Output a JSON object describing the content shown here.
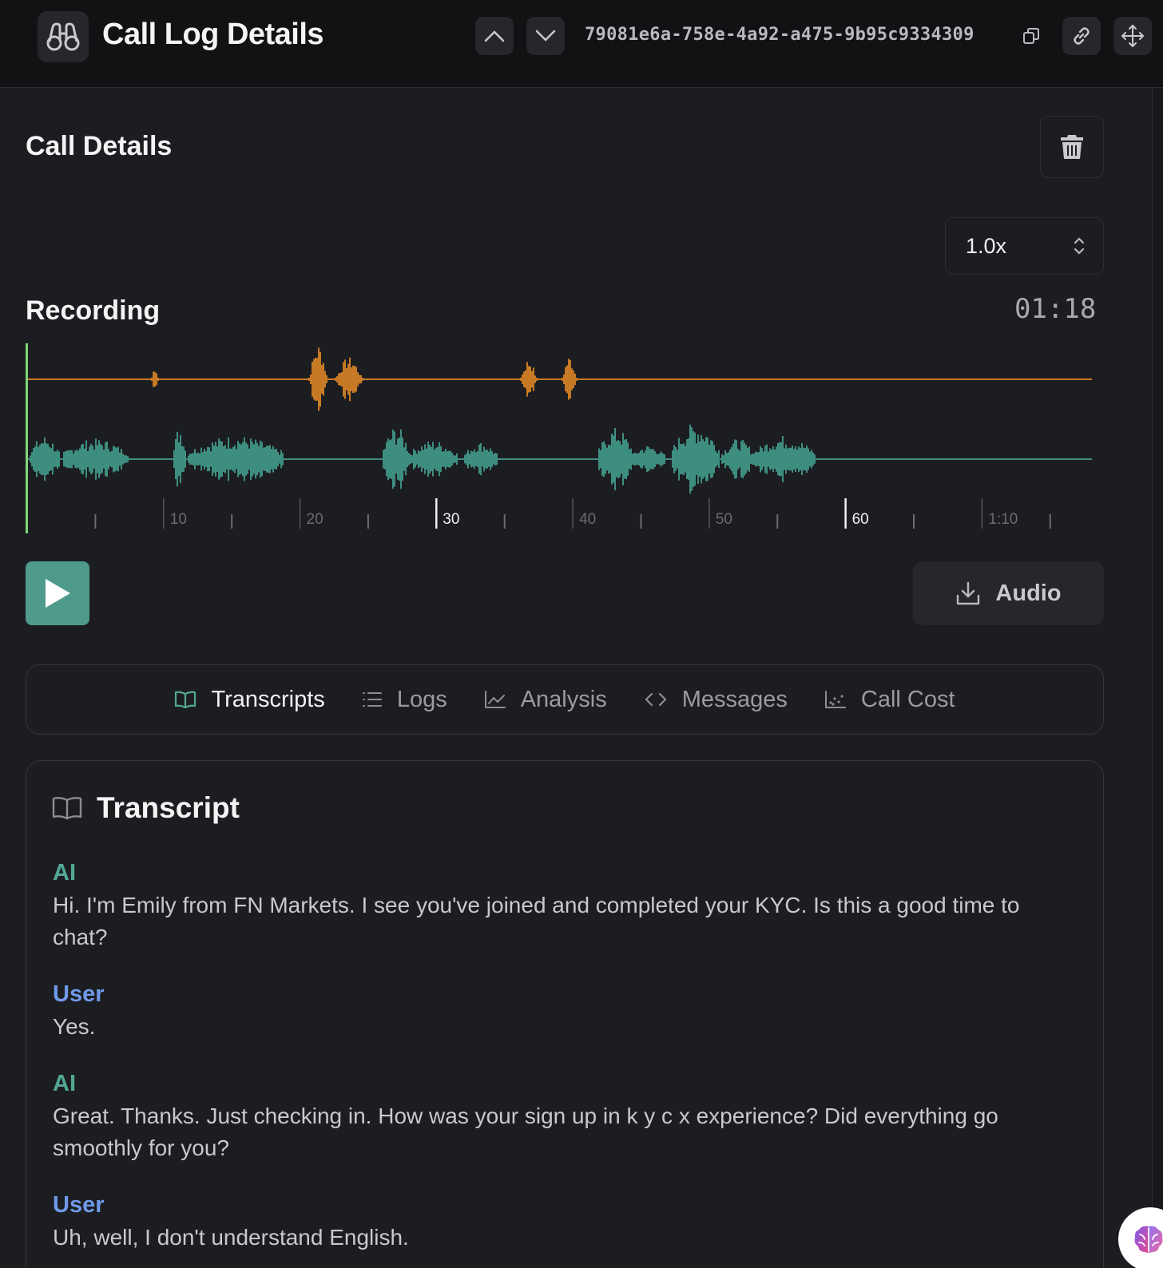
{
  "header": {
    "title": "Call Log Details",
    "call_id": "79081e6a-758e-4a92-a475-9b95c9334309"
  },
  "call_details": {
    "title": "Call Details",
    "playback_speed": "1.0x"
  },
  "recording": {
    "title": "Recording",
    "duration": "01:18",
    "time_axis": {
      "labels": [
        "10",
        "20",
        "30",
        "40",
        "50",
        "60",
        "1:10"
      ],
      "highlighted": [
        "30",
        "60"
      ]
    },
    "colors": {
      "assistant_track": "#c77a25",
      "user_track": "#3e8e80",
      "playhead": "#7ed67a"
    }
  },
  "player": {
    "audio_label": "Audio"
  },
  "tabs": [
    {
      "label": "Transcripts",
      "icon": "book-open-icon",
      "active": true
    },
    {
      "label": "Logs",
      "icon": "list-icon",
      "active": false
    },
    {
      "label": "Analysis",
      "icon": "line-chart-icon",
      "active": false
    },
    {
      "label": "Messages",
      "icon": "code-icon",
      "active": false
    },
    {
      "label": "Call Cost",
      "icon": "scatter-chart-icon",
      "active": false
    }
  ],
  "transcript": {
    "title": "Transcript",
    "messages": [
      {
        "speaker": "AI",
        "text": "Hi. I'm Emily from FN Markets. I see you've joined and completed your KYC. Is this a good time to chat?"
      },
      {
        "speaker": "User",
        "text": "Yes."
      },
      {
        "speaker": "AI",
        "text": "Great. Thanks. Just checking in. How was your sign up in k y c x experience? Did everything go smoothly for you?"
      },
      {
        "speaker": "User",
        "text": "Uh, well, I don't understand English."
      }
    ]
  },
  "theme": {
    "accent": "#4e9a8b",
    "ai_label": "#52a895",
    "user_label": "#6f9ae8"
  }
}
